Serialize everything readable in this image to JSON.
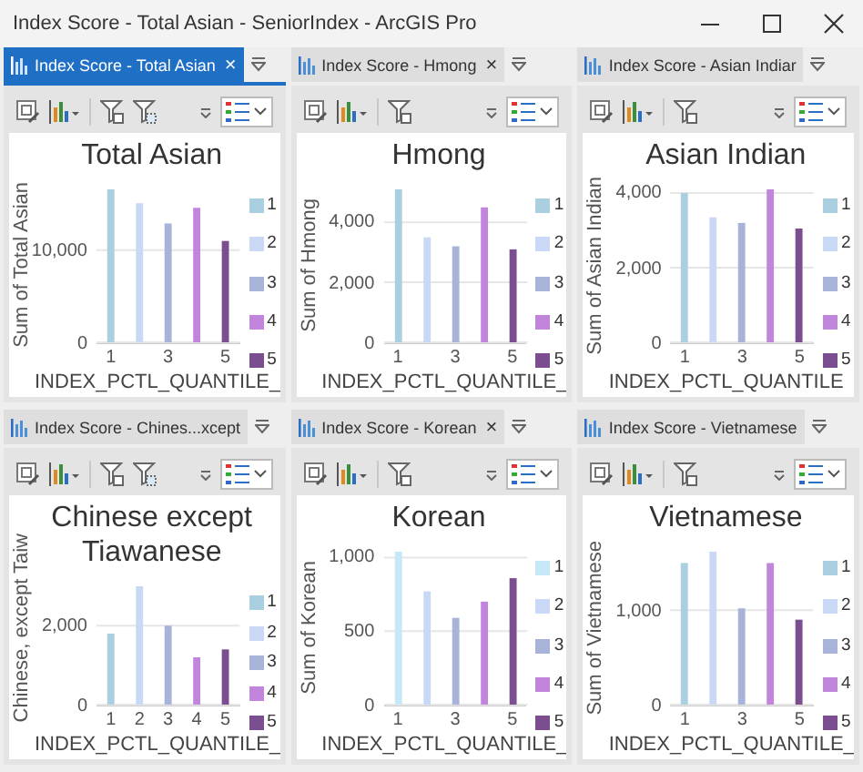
{
  "window": {
    "title": "Index Score - Total Asian - SeniorIndex - ArcGIS Pro"
  },
  "panels": [
    {
      "tab": {
        "label": "Index Score - Total Asian",
        "selected": true,
        "close": "×"
      },
      "toolbar": {
        "filters": [
          {
            "kind": "extent"
          },
          {
            "kind": "selection"
          }
        ]
      },
      "chart_data": {
        "type": "bar",
        "title": "Total Asian",
        "xlabel": "INDEX_PCTL_QUANTILE_",
        "ylabel": "Sum of Total Asian",
        "legend": true,
        "x": [
          1,
          2,
          3,
          4,
          5
        ],
        "xlim": [
          0.5,
          5.5
        ],
        "ylim": [
          0,
          16600
        ],
        "yticks": [
          {
            "value": 0,
            "label": "0"
          },
          {
            "value": 10000,
            "label": "10,000"
          }
        ],
        "xticks": [
          1,
          3,
          5
        ],
        "series": [
          {
            "name": "1",
            "color": "#a9cfe0",
            "values": [
              16600,
              null,
              null,
              null,
              null
            ]
          },
          {
            "name": "2",
            "color": "#c9d9f5",
            "values": [
              null,
              15100,
              null,
              null,
              null
            ]
          },
          {
            "name": "3",
            "color": "#a7b3d8",
            "values": [
              null,
              null,
              12900,
              null,
              null
            ]
          },
          {
            "name": "4",
            "color": "#c285dc",
            "values": [
              null,
              null,
              null,
              14600,
              null
            ]
          },
          {
            "name": "5",
            "color": "#7b4f8f",
            "values": [
              null,
              null,
              null,
              null,
              11000
            ]
          }
        ]
      }
    },
    {
      "tab": {
        "label": "Index Score - Hmong",
        "selected": false,
        "close": "×"
      },
      "toolbar": {
        "filters": [
          {
            "kind": "extent"
          }
        ]
      },
      "chart_data": {
        "type": "bar",
        "title": "Hmong",
        "xlabel": "INDEX_PCTL_QUANTILE_",
        "ylabel": "Sum of Hmong",
        "legend": true,
        "x": [
          1,
          2,
          3,
          4,
          5
        ],
        "xlim": [
          0.5,
          5.5
        ],
        "ylim": [
          0,
          5100
        ],
        "yticks": [
          {
            "value": 0,
            "label": "0"
          },
          {
            "value": 2000,
            "label": "2,000"
          },
          {
            "value": 4000,
            "label": "4,000"
          }
        ],
        "xticks": [
          1,
          3,
          5
        ],
        "series": [
          {
            "name": "1",
            "color": "#a9cfe0",
            "values": [
              5100,
              null,
              null,
              null,
              null
            ]
          },
          {
            "name": "2",
            "color": "#c9d9f5",
            "values": [
              null,
              3500,
              null,
              null,
              null
            ]
          },
          {
            "name": "3",
            "color": "#a7b3d8",
            "values": [
              null,
              null,
              3200,
              null,
              null
            ]
          },
          {
            "name": "4",
            "color": "#c285dc",
            "values": [
              null,
              null,
              null,
              4500,
              null
            ]
          },
          {
            "name": "5",
            "color": "#7b4f8f",
            "values": [
              null,
              null,
              null,
              null,
              3100
            ]
          }
        ]
      }
    },
    {
      "tab": {
        "label": "Index Score - Asian Indiar",
        "selected": false
      },
      "toolbar": {
        "filters": [
          {
            "kind": "extent"
          }
        ]
      },
      "chart_data": {
        "type": "bar",
        "title": "Asian Indian",
        "xlabel": "INDEX_PCTL_QUANTILE",
        "ylabel": "Sum of Asian Indian",
        "legend": true,
        "x": [
          1,
          2,
          3,
          4,
          5
        ],
        "xlim": [
          0.5,
          5.5
        ],
        "ylim": [
          0,
          4100
        ],
        "yticks": [
          {
            "value": 0,
            "label": "0"
          },
          {
            "value": 2000,
            "label": "2,000"
          },
          {
            "value": 4000,
            "label": "4,000"
          }
        ],
        "xticks": [
          1,
          3,
          5
        ],
        "series": [
          {
            "name": "1",
            "color": "#a9cfe0",
            "values": [
              4000,
              null,
              null,
              null,
              null
            ]
          },
          {
            "name": "2",
            "color": "#c9d9f5",
            "values": [
              null,
              3350,
              null,
              null,
              null
            ]
          },
          {
            "name": "3",
            "color": "#a7b3d8",
            "values": [
              null,
              null,
              3200,
              null,
              null
            ]
          },
          {
            "name": "4",
            "color": "#c285dc",
            "values": [
              null,
              null,
              null,
              4100,
              null
            ]
          },
          {
            "name": "5",
            "color": "#7b4f8f",
            "values": [
              null,
              null,
              null,
              null,
              3050
            ]
          }
        ]
      }
    },
    {
      "tab": {
        "label": "Index Score - Chines...xcept",
        "selected": false
      },
      "toolbar": {
        "filters": [
          {
            "kind": "extent"
          },
          {
            "kind": "selection"
          }
        ]
      },
      "chart_data": {
        "type": "bar",
        "title": "Chinese except Tiawanese",
        "xlabel": "INDEX_PCTL_QUANTILE_",
        "ylabel": "Chinese, except Taiw",
        "legend": true,
        "x": [
          1,
          2,
          3,
          4,
          5
        ],
        "xlim": [
          0.5,
          5.5
        ],
        "ylim": [
          0,
          3000
        ],
        "yticks": [
          {
            "value": 0,
            "label": "0"
          },
          {
            "value": 2000,
            "label": "2,000"
          }
        ],
        "xticks": [
          1,
          2,
          3,
          4,
          5
        ],
        "series": [
          {
            "name": "1",
            "color": "#a9cfe0",
            "values": [
              1800,
              null,
              null,
              null,
              null
            ]
          },
          {
            "name": "2",
            "color": "#c9d9f5",
            "values": [
              null,
              3000,
              null,
              null,
              null
            ]
          },
          {
            "name": "3",
            "color": "#a7b3d8",
            "values": [
              null,
              null,
              2000,
              null,
              null
            ]
          },
          {
            "name": "4",
            "color": "#c285dc",
            "values": [
              null,
              null,
              null,
              1200,
              null
            ]
          },
          {
            "name": "5",
            "color": "#7b4f8f",
            "values": [
              null,
              null,
              null,
              null,
              1400
            ]
          }
        ]
      }
    },
    {
      "tab": {
        "label": "Index Score - Korean",
        "selected": false,
        "close": "×"
      },
      "toolbar": {
        "filters": [
          {
            "kind": "extent"
          }
        ]
      },
      "chart_data": {
        "type": "bar",
        "title": "Korean",
        "xlabel": "INDEX_PCTL_QUANTILE_",
        "ylabel": "Sum of Korean",
        "legend": true,
        "x": [
          1,
          2,
          3,
          4,
          5
        ],
        "xlim": [
          0.5,
          5.5
        ],
        "ylim": [
          0,
          1040
        ],
        "yticks": [
          {
            "value": 0,
            "label": "0"
          },
          {
            "value": 500,
            "label": "500"
          },
          {
            "value": 1000,
            "label": "1,000"
          }
        ],
        "xticks": [
          1,
          3,
          5
        ],
        "series": [
          {
            "name": "1",
            "color": "#c6e8f7",
            "values": [
              1040,
              null,
              null,
              null,
              null
            ]
          },
          {
            "name": "2",
            "color": "#c9d9f5",
            "values": [
              null,
              770,
              null,
              null,
              null
            ]
          },
          {
            "name": "3",
            "color": "#a7b3d8",
            "values": [
              null,
              null,
              590,
              null,
              null
            ]
          },
          {
            "name": "4",
            "color": "#c285dc",
            "values": [
              null,
              null,
              null,
              700,
              null
            ]
          },
          {
            "name": "5",
            "color": "#7b4f8f",
            "values": [
              null,
              null,
              null,
              null,
              860
            ]
          }
        ]
      }
    },
    {
      "tab": {
        "label": "Index Score - Vietnamese",
        "selected": false
      },
      "toolbar": {
        "filters": [
          {
            "kind": "extent"
          }
        ]
      },
      "chart_data": {
        "type": "bar",
        "title": "Vietnamese",
        "xlabel": "INDEX_PCTL_QUANTILE_",
        "ylabel": "Sum of Vietnamese",
        "legend": true,
        "x": [
          1,
          2,
          3,
          4,
          5
        ],
        "xlim": [
          0.5,
          5.5
        ],
        "ylim": [
          0,
          1620
        ],
        "yticks": [
          {
            "value": 0,
            "label": "0"
          },
          {
            "value": 1000,
            "label": "1,000"
          }
        ],
        "xticks": [
          1,
          3,
          5
        ],
        "series": [
          {
            "name": "1",
            "color": "#a9cfe0",
            "values": [
              1500,
              null,
              null,
              null,
              null
            ]
          },
          {
            "name": "2",
            "color": "#c9d9f5",
            "values": [
              null,
              1620,
              null,
              null,
              null
            ]
          },
          {
            "name": "3",
            "color": "#a7b3d8",
            "values": [
              null,
              null,
              1020,
              null,
              null
            ]
          },
          {
            "name": "4",
            "color": "#c285dc",
            "values": [
              null,
              null,
              null,
              1500,
              null
            ]
          },
          {
            "name": "5",
            "color": "#7b4f8f",
            "values": [
              null,
              null,
              null,
              null,
              900
            ]
          }
        ]
      }
    }
  ]
}
